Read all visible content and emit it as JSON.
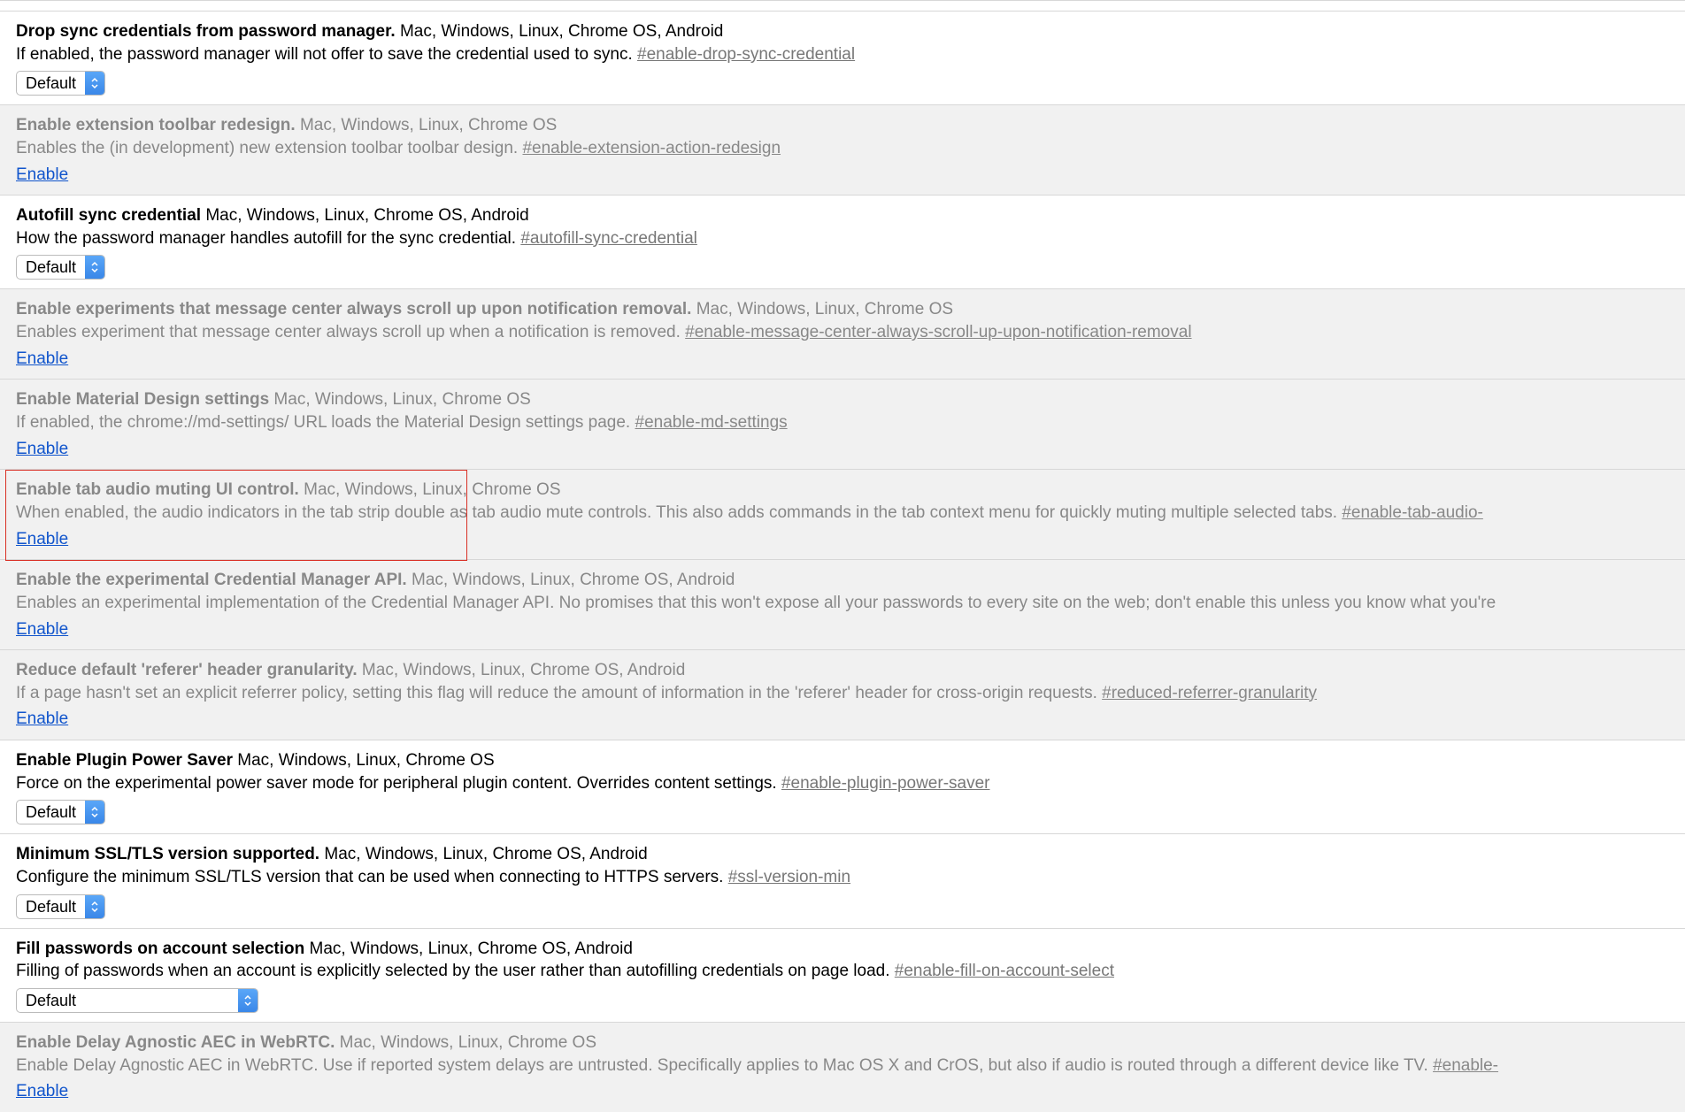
{
  "select_default": "Default",
  "enable_label": "Enable",
  "flags": [
    {
      "id": "drop-sync",
      "title": "Drop sync credentials from password manager.",
      "platforms": "Mac, Windows, Linux, Chrome OS, Android",
      "desc": "If enabled, the password manager will not offer to save the credential used to sync.",
      "hash": "#enable-drop-sync-credential",
      "control": "select",
      "unavailable": false
    },
    {
      "id": "ext-toolbar",
      "title": "Enable extension toolbar redesign.",
      "platforms": "Mac, Windows, Linux, Chrome OS",
      "desc": "Enables the (in development) new extension toolbar toolbar design.",
      "hash": "#enable-extension-action-redesign",
      "control": "link",
      "unavailable": true
    },
    {
      "id": "autofill-sync",
      "title": "Autofill sync credential",
      "platforms": "Mac, Windows, Linux, Chrome OS, Android",
      "desc": "How the password manager handles autofill for the sync credential.",
      "hash": "#autofill-sync-credential",
      "control": "select",
      "unavailable": false
    },
    {
      "id": "msg-center-scroll",
      "title": "Enable experiments that message center always scroll up upon notification removal.",
      "platforms": "Mac, Windows, Linux, Chrome OS",
      "desc": "Enables experiment that message center always scroll up when a notification is removed.",
      "hash": "#enable-message-center-always-scroll-up-upon-notification-removal",
      "control": "link",
      "unavailable": true
    },
    {
      "id": "md-settings",
      "title": "Enable Material Design settings",
      "platforms": "Mac, Windows, Linux, Chrome OS",
      "desc": "If enabled, the chrome://md-settings/ URL loads the Material Design settings page.",
      "hash": "#enable-md-settings",
      "control": "link",
      "unavailable": true
    },
    {
      "id": "tab-audio-mute",
      "title": "Enable tab audio muting UI control.",
      "platforms": "Mac, Windows, Linux, Chrome OS",
      "desc": "When enabled, the audio indicators in the tab strip double as tab audio mute controls. This also adds commands in the tab context menu for quickly muting multiple selected tabs.",
      "hash": "#enable-tab-audio-",
      "control": "link",
      "unavailable": true,
      "highlight": true
    },
    {
      "id": "credential-mgr",
      "title": "Enable the experimental Credential Manager API.",
      "platforms": "Mac, Windows, Linux, Chrome OS, Android",
      "desc": "Enables an experimental implementation of the Credential Manager API. No promises that this won't expose all your passwords to every site on the web; don't enable this unless you know what you're",
      "hash": "",
      "control": "link",
      "unavailable": true
    },
    {
      "id": "referer",
      "title": "Reduce default 'referer' header granularity.",
      "platforms": "Mac, Windows, Linux, Chrome OS, Android",
      "desc": "If a page hasn't set an explicit referrer policy, setting this flag will reduce the amount of information in the 'referer' header for cross-origin requests.",
      "hash": "#reduced-referrer-granularity",
      "control": "link",
      "unavailable": true
    },
    {
      "id": "plugin-power",
      "title": "Enable Plugin Power Saver",
      "platforms": "Mac, Windows, Linux, Chrome OS",
      "desc": "Force on the experimental power saver mode for peripheral plugin content. Overrides content settings.",
      "hash": "#enable-plugin-power-saver",
      "control": "select",
      "unavailable": false
    },
    {
      "id": "ssl-min",
      "title": "Minimum SSL/TLS version supported.",
      "platforms": "Mac, Windows, Linux, Chrome OS, Android",
      "desc": "Configure the minimum SSL/TLS version that can be used when connecting to HTTPS servers.",
      "hash": "#ssl-version-min",
      "control": "select",
      "unavailable": false
    },
    {
      "id": "fill-on-select",
      "title": "Fill passwords on account selection",
      "platforms": "Mac, Windows, Linux, Chrome OS, Android",
      "desc": "Filling of passwords when an account is explicitly selected by the user rather than autofilling credentials on page load.",
      "hash": "#enable-fill-on-account-select",
      "control": "select",
      "select_width": "wide",
      "unavailable": false
    },
    {
      "id": "aec",
      "title": "Enable Delay Agnostic AEC in WebRTC.",
      "platforms": "Mac, Windows, Linux, Chrome OS",
      "desc": "Enable Delay Agnostic AEC in WebRTC. Use if reported system delays are untrusted. Specifically applies to Mac OS X and CrOS, but also if audio is routed through a different device like TV.",
      "hash": "#enable-",
      "control": "link",
      "unavailable": true
    }
  ]
}
